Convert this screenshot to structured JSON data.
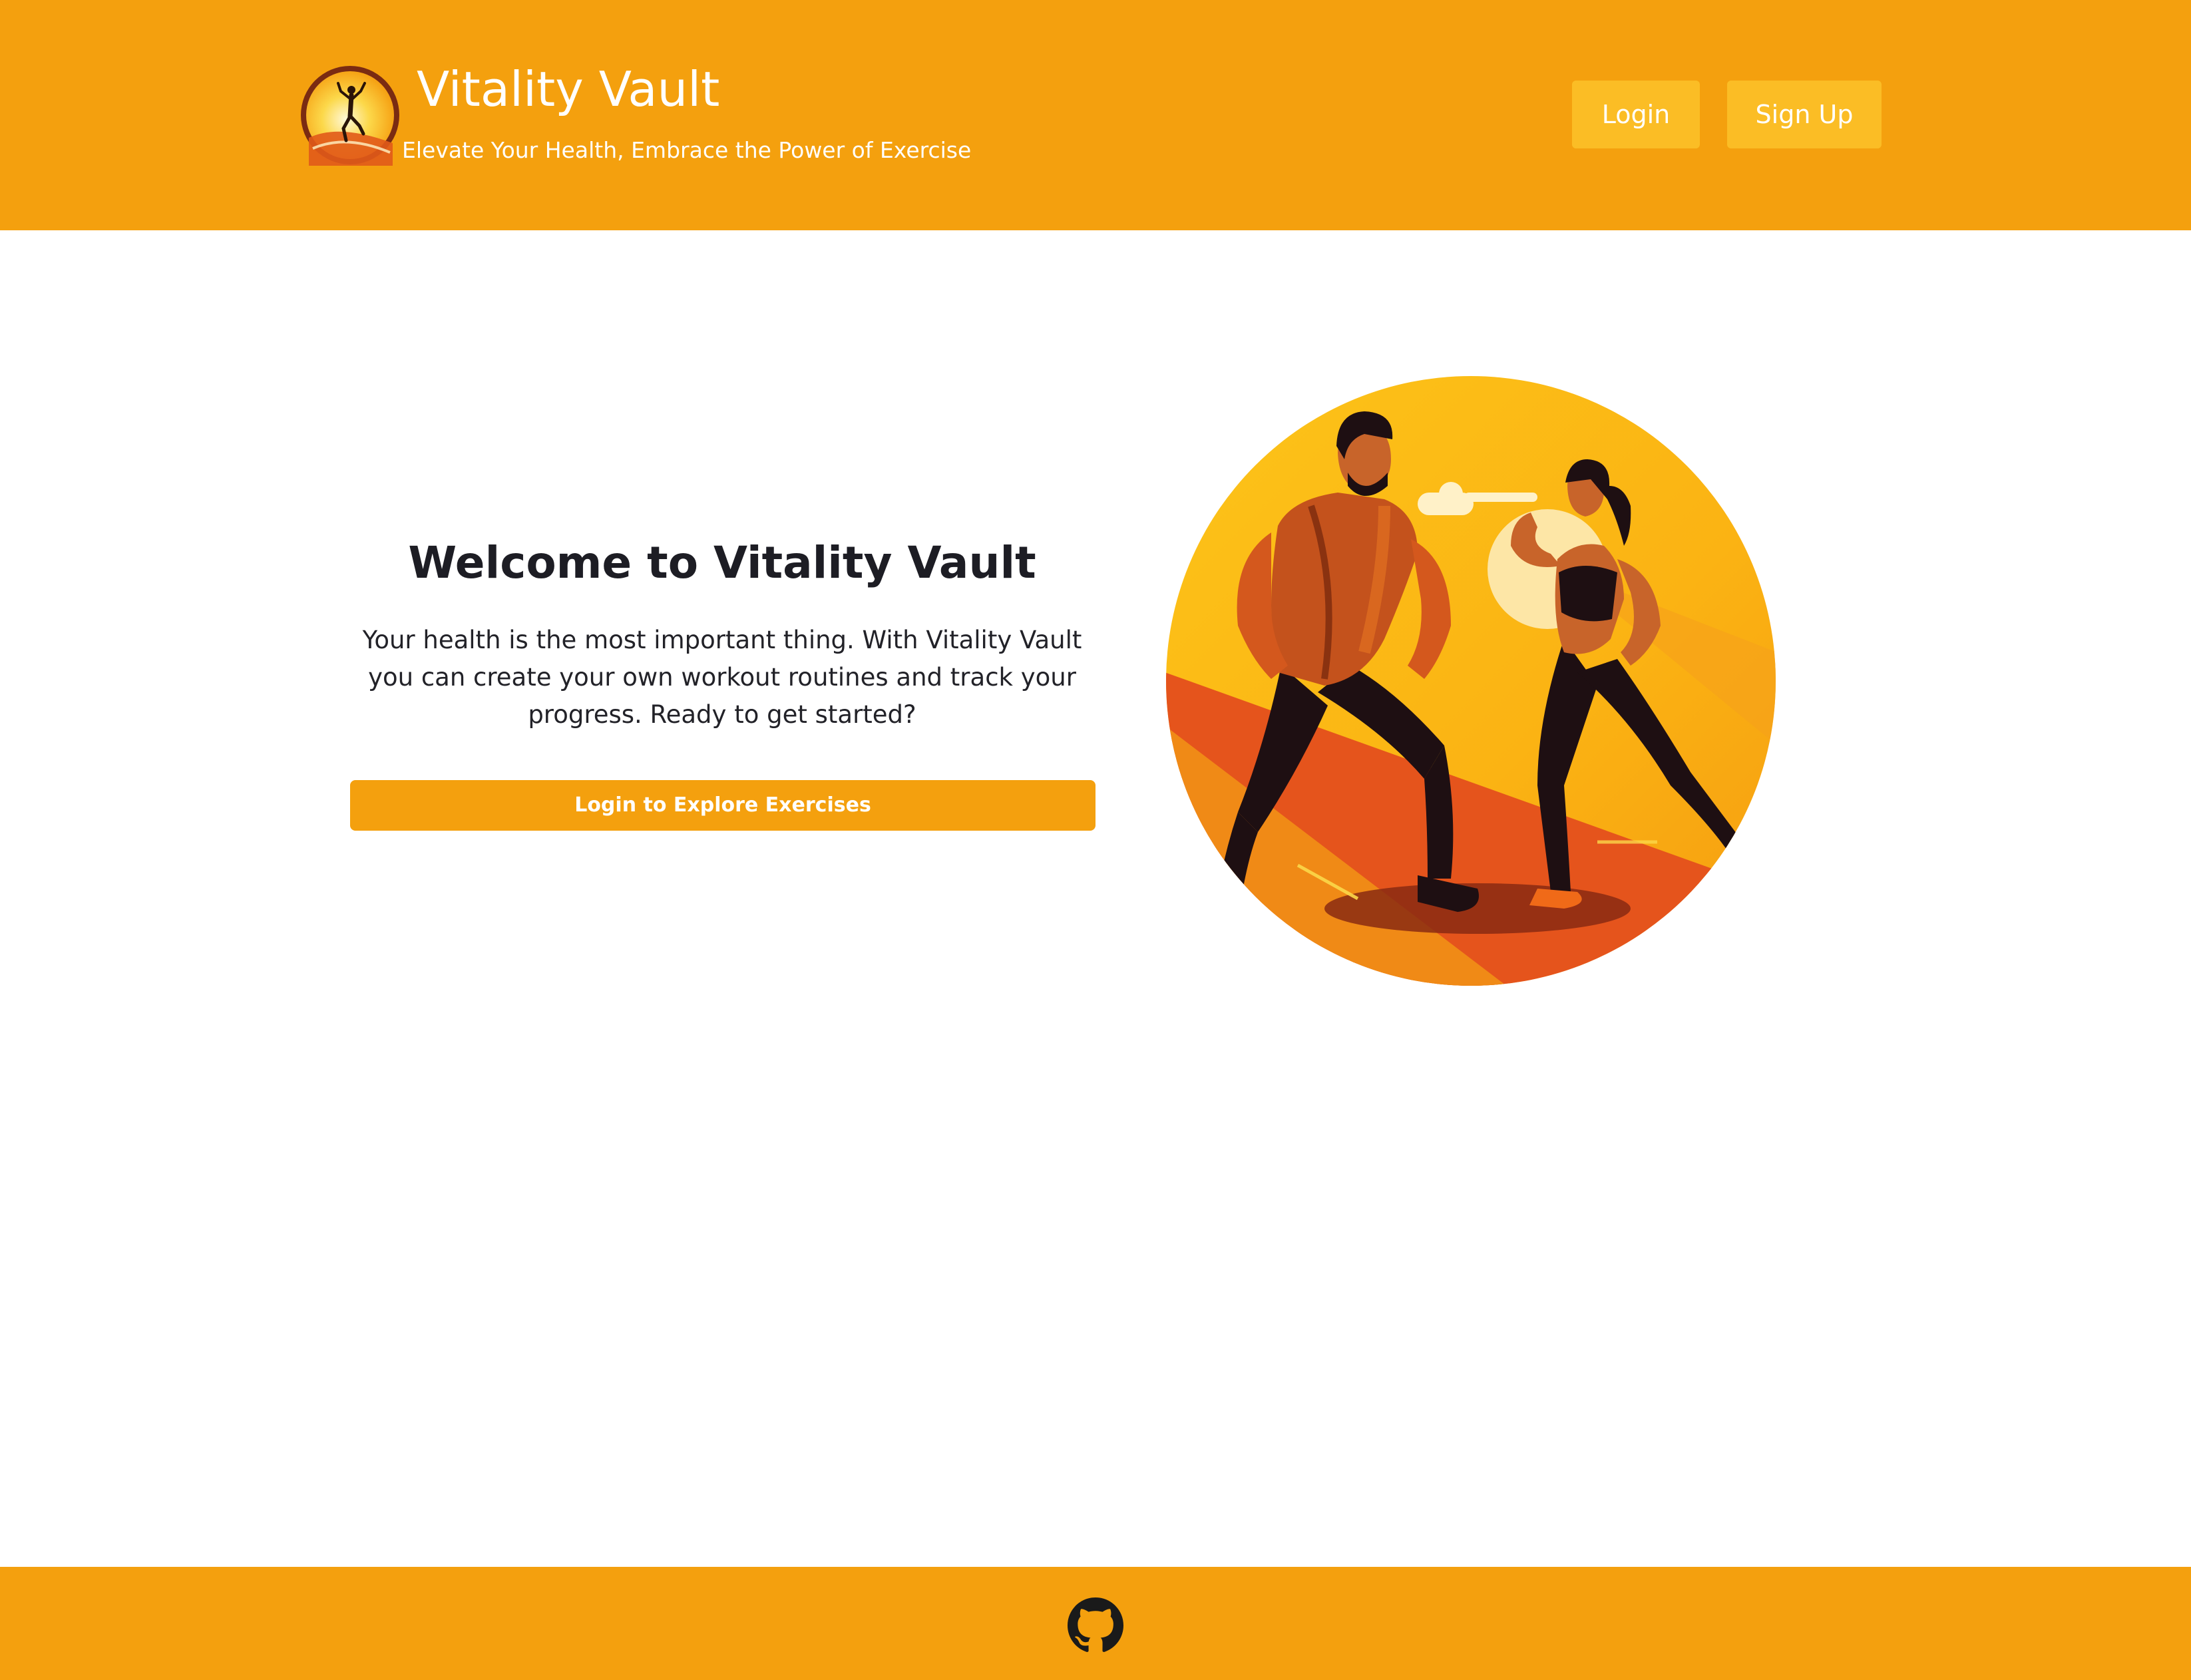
{
  "header": {
    "brand_title": "Vitality Vault",
    "brand_tagline": "Elevate Your Health, Embrace the Power of Exercise",
    "logo_icon": "runner-logo-icon",
    "nav": {
      "login_label": "Login",
      "signup_label": "Sign Up"
    }
  },
  "hero": {
    "title": "Welcome to Vitality Vault",
    "description": "Your health is the most important thing. With Vitality Vault you can create your own workout routines and track your progress. Ready to get started?",
    "cta_label": "Login to Explore Exercises",
    "illustration": "fitness-couple-illustration"
  },
  "footer": {
    "icon": "github-icon"
  },
  "colors": {
    "primary": "#f4a00e",
    "nav_button": "#fbbd25",
    "text_dark": "#1d1d24",
    "background": "#ffffff"
  }
}
